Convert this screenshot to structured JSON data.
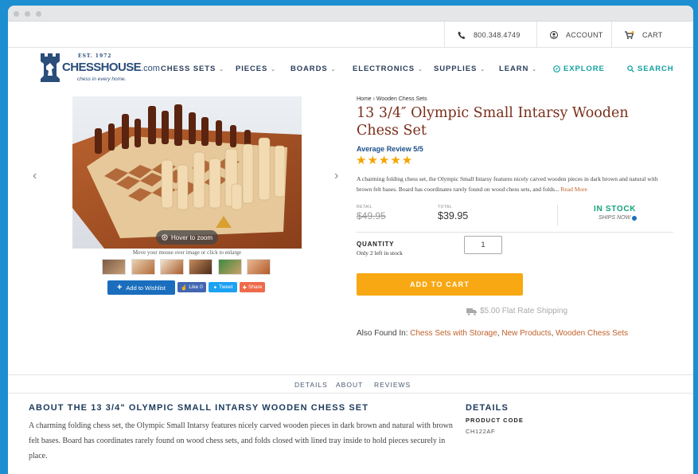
{
  "topbar": {
    "phone": "800.348.4749",
    "account": "ACCOUNT",
    "cart": "CART"
  },
  "logo": {
    "est": "EST. 1972",
    "name": "CHESSHOUSE",
    "suffix": ".com",
    "tagline": "chess in every home."
  },
  "nav": {
    "items": [
      {
        "label": "CHESS SETS"
      },
      {
        "label": "PIECES"
      },
      {
        "label": "BOARDS"
      },
      {
        "label": "ELECTRONICS"
      },
      {
        "label": "SUPPLIES"
      },
      {
        "label": "LEARN"
      }
    ],
    "explore": "EXPLORE",
    "search": "SEARCH"
  },
  "gallery": {
    "hover_zoom": "Hover to zoom",
    "hint": "Move your mouse over image or click to enlarge",
    "prev_icon": "chevron-left-icon",
    "next_icon": "chevron-right-icon"
  },
  "social": {
    "wishlist": "Add to Wishlist",
    "like": "Like 0",
    "tweet": "Tweet",
    "share": "Share",
    "colors": {
      "wishlist": "#1a6ebd",
      "like": "#4267b2",
      "tweet": "#1da1f2",
      "share": "#ee6a4a"
    }
  },
  "product": {
    "breadcrumb": "Home › Wooden Chess Sets",
    "title": "13 3/4″ Olympic Small Intarsy Wooden Chess Set",
    "avg_review": "Average Review 5/5",
    "stars": "★★★★★",
    "rating": 5,
    "description": "A charming folding chess set, the Olympic Small Intarsy features nicely carved wooden pieces in dark brown and natural with brown felt bases. Board has coordinates rarely found on wood chess sets, and folds...",
    "read_more": "Read More",
    "retail_label": "RETAIL",
    "retail_price": "$49.95",
    "total_label": "TOTAL",
    "total_price": "$39.95",
    "stock": "IN STOCK",
    "ships": "SHIPS NOW",
    "quantity_label": "QUANTITY",
    "quantity_note": "Only 2 left in stock",
    "quantity_value": "1",
    "add_to_cart": "ADD TO CART",
    "shipping": "$5.00 Flat Rate Shipping",
    "also_found_label": "Also Found In:",
    "also_found": [
      "Chess Sets with Storage",
      "New Products",
      "Wooden Chess Sets"
    ]
  },
  "tabs": [
    "DETAILS",
    "ABOUT",
    "REVIEWS"
  ],
  "about": {
    "heading": "ABOUT THE 13 3/4\" OLYMPIC SMALL INTARSY WOODEN CHESS SET",
    "body": "A charming folding chess set, the Olympic Small Intarsy features nicely carved wooden pieces in dark brown and natural with brown felt bases. Board has coordinates rarely found on wood chess sets, and folds closed with lined tray inside to hold pieces securely in place."
  },
  "details": {
    "heading": "DETAILS",
    "code_label": "PRODUCT CODE",
    "code_value": "CH122AF"
  },
  "colors": {
    "accent_orange": "#f8a813",
    "title_brown": "#7a2e1a",
    "navy": "#1b3a5c",
    "teal": "#13a0a0",
    "stock_green": "#16a27a",
    "frame_blue": "#1d8fd0"
  }
}
